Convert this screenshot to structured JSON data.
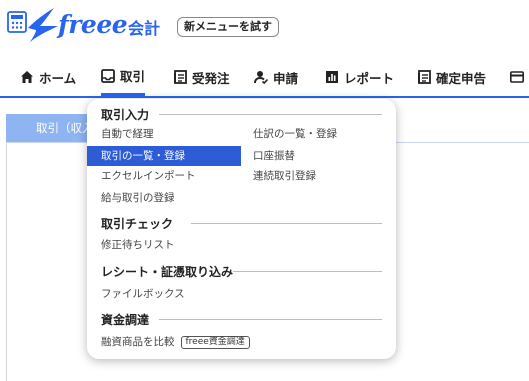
{
  "header": {
    "logo_text": "freee",
    "logo_sub": "会計",
    "try_new_menu": "新メニューを試す"
  },
  "nav": {
    "items": [
      {
        "label": "ホーム",
        "icon": "home-icon"
      },
      {
        "label": "取引",
        "icon": "tray-icon"
      },
      {
        "label": "受発注",
        "icon": "document-icon"
      },
      {
        "label": "申請",
        "icon": "person-check-icon"
      },
      {
        "label": "レポート",
        "icon": "bar-chart-icon"
      },
      {
        "label": "確定申告",
        "icon": "document-icon"
      },
      {
        "label": "",
        "icon": "card-icon"
      }
    ],
    "active_index": 1
  },
  "content": {
    "tab_label": "取引（収入"
  },
  "dropdown": {
    "sections": [
      {
        "title": "取引入力",
        "items_left": [
          "自動で経理",
          "取引の一覧・登録",
          "エクセルインポート",
          "給与取引の登録"
        ],
        "items_right": [
          "仕訳の一覧・登録",
          "口座振替",
          "連続取引登録"
        ]
      },
      {
        "title": "取引チェック",
        "items_left": [
          "修正待ちリスト"
        ]
      },
      {
        "title": "レシート・証憑取り込み",
        "items_left": [
          "ファイルボックス"
        ]
      },
      {
        "title": "資金調達",
        "items_left": [
          "融資商品を比較"
        ],
        "badge": "freee資金調達"
      }
    ],
    "selected_item": "取引の一覧・登録"
  },
  "colors": {
    "brand": "#2864f0",
    "selected_bg": "#2e5bd6",
    "content_tab": "#8fb4f2"
  }
}
